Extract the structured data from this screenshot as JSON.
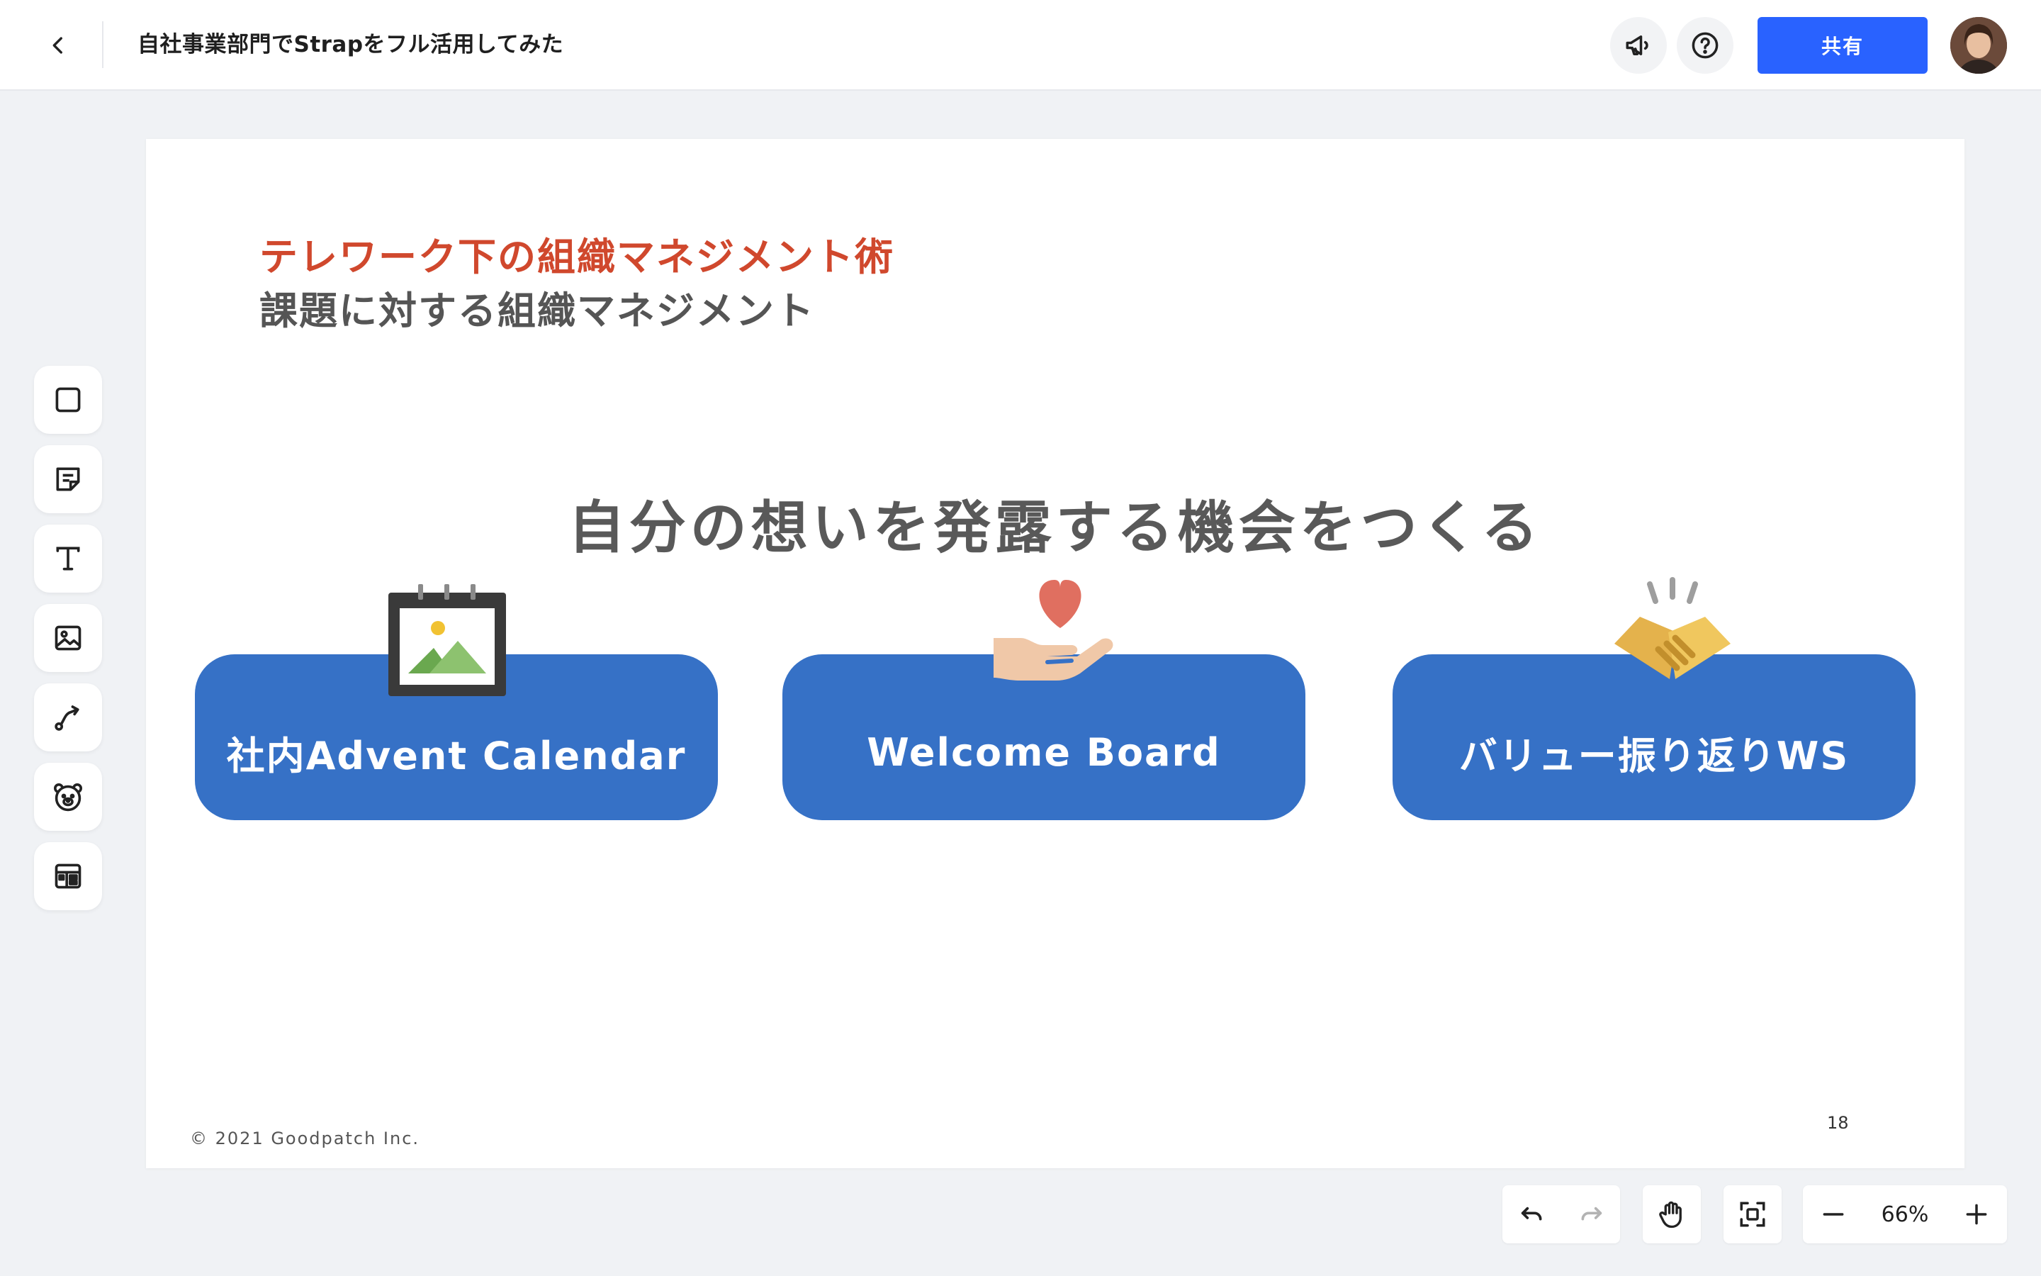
{
  "header": {
    "doc_title": "自社事業部門でStrapをフル活用してみた",
    "share_label": "共有",
    "icons": [
      "back-icon",
      "megaphone-icon",
      "help-icon",
      "avatar"
    ]
  },
  "toolbar": {
    "tools": [
      "square-icon",
      "sticky-note-icon",
      "text-icon",
      "image-icon",
      "connector-icon",
      "bear-stamp-icon",
      "template-icon"
    ]
  },
  "slide": {
    "kicker": "テレワーク下の組織マネジメント術",
    "subtitle": "課題に対する組織マネジメント",
    "headline": "自分の想いを発露する機会をつくる",
    "cards": [
      {
        "label": "社内Advent Calendar",
        "icon": "calendar-image-icon"
      },
      {
        "label": "Welcome Board",
        "icon": "hand-heart-icon"
      },
      {
        "label": "バリュー振り返りWS",
        "icon": "handshake-icon"
      }
    ],
    "copyright": "© 2021 Goodpatch Inc.",
    "page_number": "18",
    "colors": {
      "kicker": "#d0482d",
      "card": "#3671c6",
      "text": "#595959"
    }
  },
  "controls": {
    "zoom": "66%",
    "icons": [
      "undo-icon",
      "redo-icon",
      "hand-tool-icon",
      "fit-screen-icon",
      "zoom-out-icon",
      "zoom-in-icon"
    ]
  },
  "theme": {
    "accent": "#2962ff",
    "canvas_bg": "#f0f2f5"
  }
}
